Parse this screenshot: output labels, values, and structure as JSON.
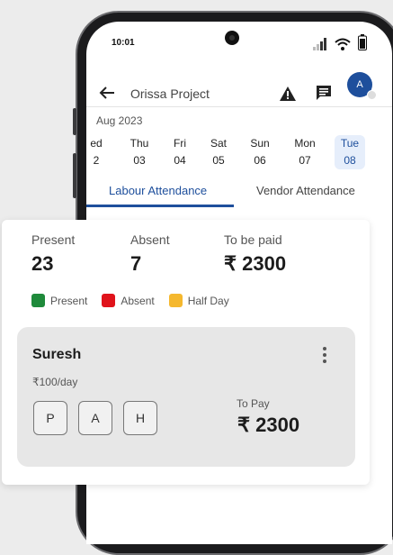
{
  "status_bar": {
    "time": "10:01"
  },
  "header": {
    "title": "Orissa Project",
    "avatar_initial": "A"
  },
  "calendar": {
    "month": "Aug 2023",
    "days": [
      {
        "name": "ed",
        "num": "2",
        "selected": false
      },
      {
        "name": "Thu",
        "num": "03",
        "selected": false
      },
      {
        "name": "Fri",
        "num": "04",
        "selected": false
      },
      {
        "name": "Sat",
        "num": "05",
        "selected": false
      },
      {
        "name": "Sun",
        "num": "06",
        "selected": false
      },
      {
        "name": "Mon",
        "num": "07",
        "selected": false
      },
      {
        "name": "Tue",
        "num": "08",
        "selected": true
      }
    ]
  },
  "tabs": [
    {
      "label": "Labour Attendance",
      "active": true
    },
    {
      "label": "Vendor Attendance",
      "active": false
    }
  ],
  "summary": {
    "present_label": "Present",
    "present_value": "23",
    "absent_label": "Absent",
    "absent_value": "7",
    "to_be_paid_label": "To be paid",
    "to_be_paid_value": "₹ 2300"
  },
  "legend": [
    {
      "label": "Present",
      "color": "#1f8a3b"
    },
    {
      "label": "Absent",
      "color": "#e0131b"
    },
    {
      "label": "Half Day",
      "color": "#f5b82e"
    }
  ],
  "worker": {
    "name": "Suresh",
    "rate": "₹100/day",
    "buttons": [
      "P",
      "A",
      "H"
    ],
    "to_pay_label": "To Pay",
    "to_pay_value": "₹ 2300"
  },
  "icons": {
    "back": "arrow-left-icon",
    "warning": "warning-icon",
    "chat": "chat-icon",
    "more": "more-vertical-icon",
    "signal": "signal-icon",
    "wifi": "wifi-icon",
    "battery": "battery-icon"
  }
}
